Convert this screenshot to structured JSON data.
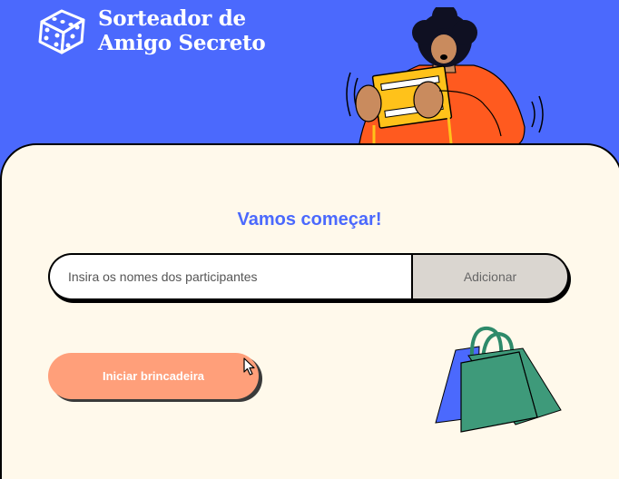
{
  "header": {
    "title_line1": "Sorteador de",
    "title_line2": "Amigo Secreto",
    "logo_icon": "dice-icon",
    "illustration": "person-holding-gift-icon"
  },
  "main": {
    "heading": "Vamos começar!",
    "name_input": {
      "placeholder": "Insira os nomes dos participantes",
      "value": ""
    },
    "add_button_label": "Adicionar",
    "start_button_label": "Iniciar brincadeira",
    "decoration": "shopping-bags-icon"
  },
  "colors": {
    "header_bg": "#4B69FD",
    "card_bg": "#FFF9EB",
    "heading": "#4B69FD",
    "start_button": "#FF9F7A",
    "add_button": "#DAD6D0"
  }
}
